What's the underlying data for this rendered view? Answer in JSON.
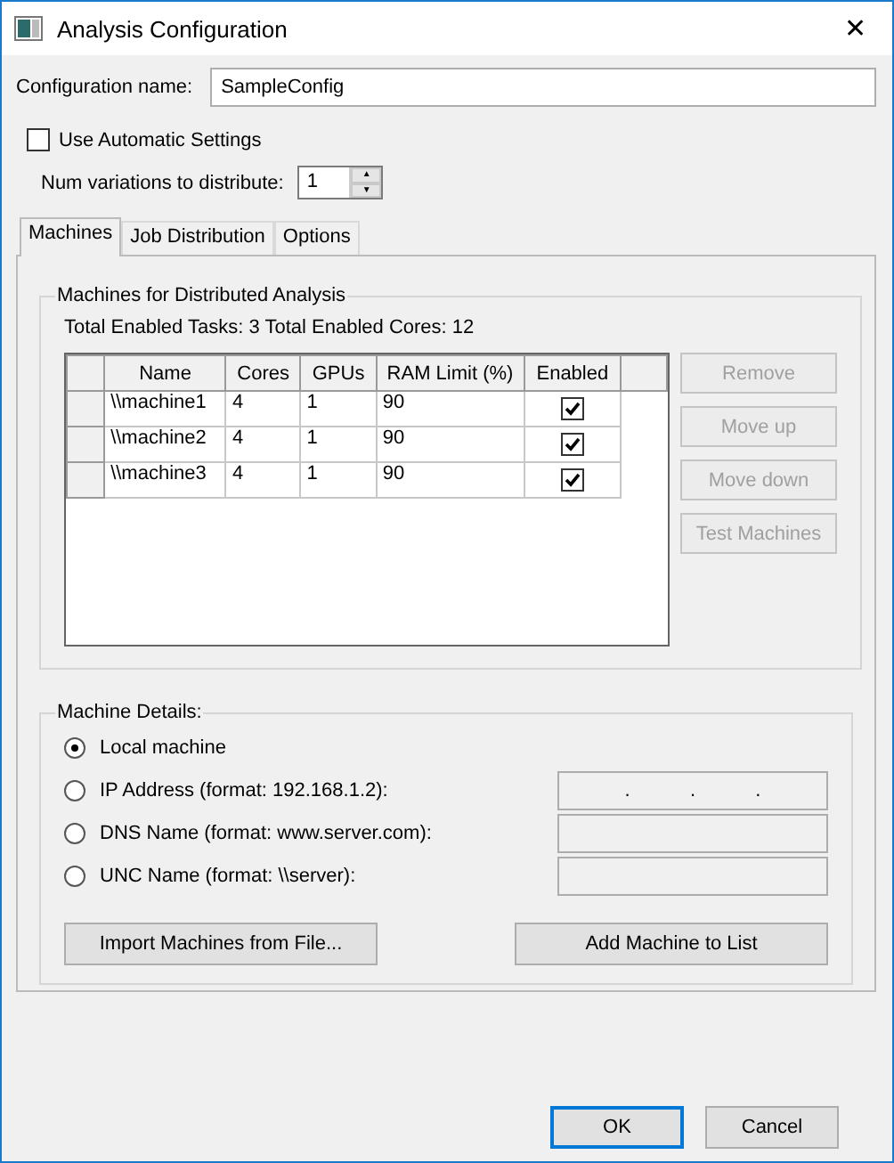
{
  "window": {
    "title": "Analysis Configuration",
    "close": "✕"
  },
  "config_name": {
    "label": "Configuration name:",
    "value": "SampleConfig"
  },
  "automatic": {
    "label": "Use Automatic Settings",
    "checked": false
  },
  "variations": {
    "label": "Num variations to distribute:",
    "value": "1",
    "up": "▲",
    "down": "▼"
  },
  "tabs": [
    {
      "label": "Machines",
      "selected": true
    },
    {
      "label": "Job Distribution",
      "selected": false
    },
    {
      "label": "Options",
      "selected": false
    }
  ],
  "machines_group": {
    "title": "Machines for Distributed Analysis",
    "totals": "Total Enabled Tasks: 3  Total Enabled Cores: 12",
    "table": {
      "columns": [
        "Name",
        "Cores",
        "GPUs",
        "RAM Limit (%)",
        "Enabled"
      ],
      "rows": [
        {
          "name": "\\\\machine1",
          "cores": "4",
          "gpus": "1",
          "ram": "90",
          "enabled": true
        },
        {
          "name": "\\\\machine2",
          "cores": "4",
          "gpus": "1",
          "ram": "90",
          "enabled": true
        },
        {
          "name": "\\\\machine3",
          "cores": "4",
          "gpus": "1",
          "ram": "90",
          "enabled": true
        }
      ]
    },
    "buttons": [
      {
        "label": "Remove",
        "disabled": true
      },
      {
        "label": "Move up",
        "disabled": true
      },
      {
        "label": "Move down",
        "disabled": true
      },
      {
        "label": "Test Machines",
        "disabled": true
      }
    ]
  },
  "details_group": {
    "title": "Machine Details:",
    "options": [
      {
        "label": "Local machine",
        "selected": true
      },
      {
        "label": "IP Address (format: 192.168.1.2):",
        "selected": false,
        "field": {
          "kind": "ip",
          "separators": [
            ".",
            ".",
            "."
          ],
          "disabled": true
        }
      },
      {
        "label": "DNS Name (format: www.server.com):",
        "selected": false,
        "field": {
          "kind": "text",
          "disabled": true
        }
      },
      {
        "label": "UNC Name (format: \\\\server):",
        "selected": false,
        "field": {
          "kind": "text",
          "disabled": true
        }
      }
    ],
    "import_button": "Import Machines from File...",
    "add_button": "Add Machine to List"
  },
  "buttons": [
    "OK",
    "Cancel"
  ]
}
